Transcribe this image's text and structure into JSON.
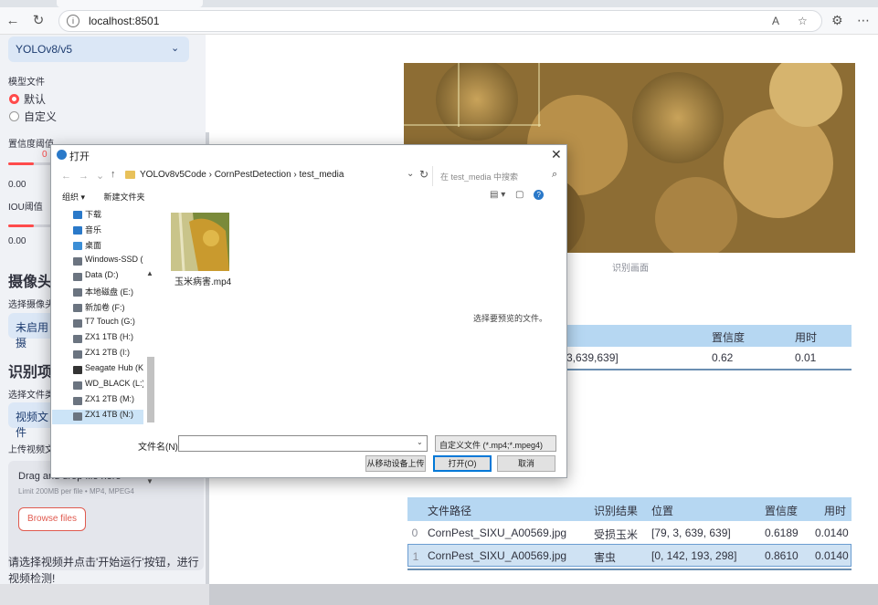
{
  "browser": {
    "url": "localhost:8501"
  },
  "sidebar": {
    "model_select": "YOLOv8/v5",
    "model_file_label": "模型文件",
    "model_options": [
      "默认",
      "自定义"
    ],
    "conf_label": "置信度阈值",
    "conf_value": "0",
    "iou_label": "IOU阈值",
    "iou_value": "0.00",
    "slider_min": "0.00",
    "camera_heading": "摄像头",
    "camera_select_label": "选择摄像头",
    "camera_button": "未启用摄",
    "recognize_heading": "识别项目",
    "file_type_label": "选择文件类",
    "file_type_button": "视频文件",
    "upload_label": "上传视频文",
    "uploader_drag": "Drag and drop file here",
    "uploader_limit": "Limit 200MB per file • MP4, MPEG4",
    "browse_button": "Browse files",
    "message": "请选择视频并点击'开始运行'按钮，进行视频检测!"
  },
  "main": {
    "frame_caption": "识别画面",
    "table1": {
      "headers": [
        "置信度",
        "用时"
      ],
      "row": {
        "position": "3,639,639]",
        "confidence": "0.62",
        "time": "0.01"
      }
    },
    "table2": {
      "headers": [
        "文件路径",
        "识别结果",
        "位置",
        "置信度",
        "用时"
      ],
      "rows": [
        {
          "index": "0",
          "path": "CornPest_SIXU_A00569.jpg",
          "result": "受损玉米",
          "position": "[79, 3, 639, 639]",
          "confidence": "0.6189",
          "time": "0.0140"
        },
        {
          "index": "1",
          "path": "CornPest_SIXU_A00569.jpg",
          "result": "害虫",
          "position": "[0, 142, 193, 298]",
          "confidence": "0.8610",
          "time": "0.0140"
        }
      ]
    }
  },
  "dialog": {
    "title": "打开",
    "breadcrumb": "YOLOv8v5Code  ›  CornPestDetection  ›  test_media",
    "search_placeholder": "在 test_media 中搜索",
    "organize": "组织 ▾",
    "new_folder": "新建文件夹",
    "nav_items": [
      "下载",
      "音乐",
      "桌面",
      "Windows-SSD (C",
      "Data (D:)",
      "本地磁盘 (E:)",
      "新加卷 (F:)",
      "T7 Touch (G:)",
      "ZX1 1TB (H:)",
      "ZX1 2TB (I:)",
      "Seagate Hub (K:",
      "WD_BLACK (L:)",
      "ZX1 2TB (M:)",
      "ZX1 4TB (N:)"
    ],
    "file_name": "玉米病害.mp4",
    "preview_message": "选择要预览的文件。",
    "filename_label": "文件名(N):",
    "filter_label": "自定义文件 (*.mp4;*.mpeg4)",
    "btn_upload_device": "从移动设备上传",
    "btn_open": "打开(O)",
    "btn_cancel": "取消"
  }
}
